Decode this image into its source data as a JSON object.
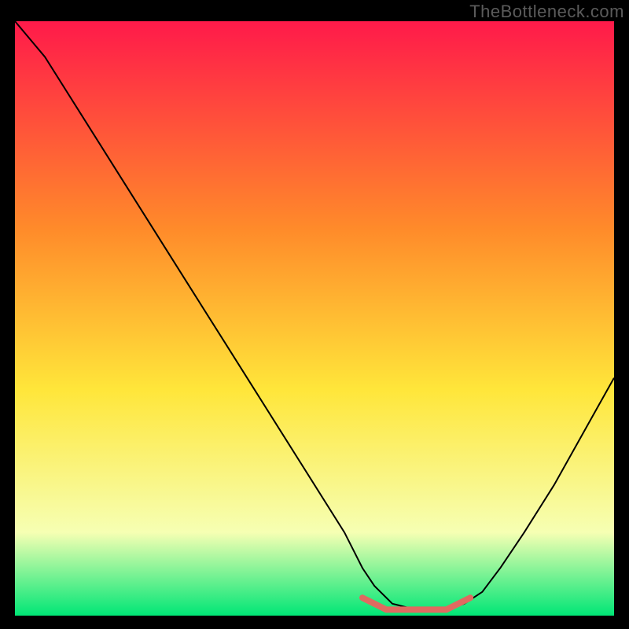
{
  "watermark": "TheBottleneck.com",
  "chart_data": {
    "type": "line",
    "title": "",
    "xlabel": "",
    "ylabel": "",
    "xlim": [
      0,
      100
    ],
    "ylim": [
      0,
      100
    ],
    "grid": false,
    "legend": false,
    "annotations": [],
    "background_gradient": {
      "top": "#ff1a4a",
      "mid1": "#ff8b2a",
      "mid2": "#ffe63a",
      "near_bottom": "#f6ffb3",
      "bottom": "#00e676"
    },
    "series": [
      {
        "name": "bottleneck-curve",
        "stroke": "#000000",
        "stroke_width": 2,
        "x": [
          0,
          5,
          10,
          15,
          20,
          25,
          30,
          35,
          40,
          45,
          50,
          55,
          58,
          60,
          63,
          67,
          72,
          75,
          78,
          81,
          85,
          90,
          95,
          100
        ],
        "values": [
          100,
          94,
          86,
          78,
          70,
          62,
          54,
          46,
          38,
          30,
          22,
          14,
          8,
          5,
          2,
          1,
          1,
          2,
          4,
          8,
          14,
          22,
          31,
          40
        ]
      },
      {
        "name": "optimal-range-marker",
        "stroke": "#e06a60",
        "stroke_width": 8,
        "x": [
          58,
          62,
          67,
          72,
          76
        ],
        "values": [
          3,
          1,
          1,
          1,
          3
        ]
      }
    ]
  }
}
